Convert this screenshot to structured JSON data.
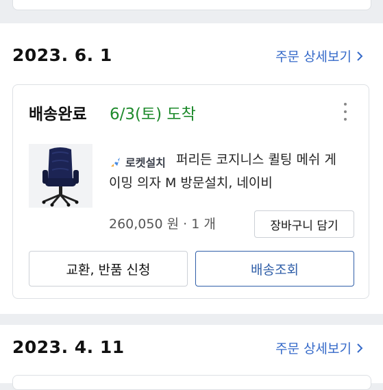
{
  "orders": [
    {
      "date": "2023. 6. 1",
      "detail_link": "주문 상세보기",
      "status": "배송완료",
      "arrival": "6/3(토) 도착",
      "badge": "로켓설치",
      "product_name": "퍼리든 코지니스 퀼팅 메쉬 게이밍 의자 M 방문설치, 네이비",
      "price_qty": "260,050 원 · 1 개",
      "cart_button": "장바구니 담기",
      "return_button": "교환, 반품 신청",
      "track_button": "배송조회"
    },
    {
      "date": "2023. 4. 11",
      "detail_link": "주문 상세보기"
    }
  ],
  "colors": {
    "link": "#3469c9",
    "arrival_green": "#1d8a2b",
    "track_blue": "#2f5ea8",
    "background": "#eceef1"
  },
  "icons": {
    "chevron": "chevron-right-icon",
    "more": "more-vertical-icon",
    "rocket": "rocket-install-icon"
  }
}
